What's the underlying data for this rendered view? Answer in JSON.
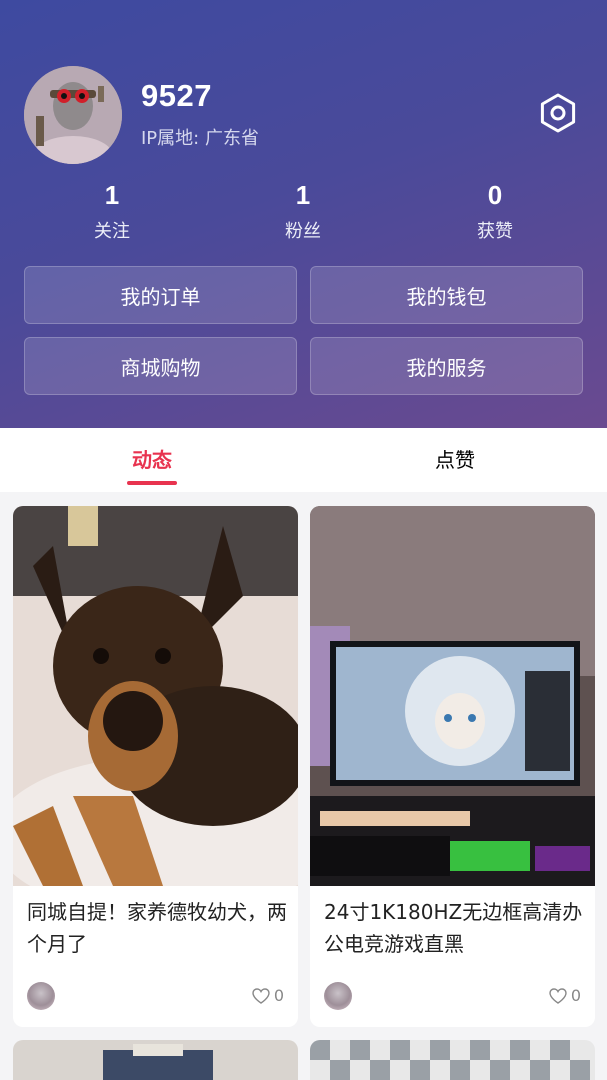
{
  "profile": {
    "username": "9527",
    "ip_location": "IP属地: 广东省",
    "avatar_icon": "avatar-image",
    "settings_icon": "gear-icon"
  },
  "stats": [
    {
      "value": "1",
      "label": "关注"
    },
    {
      "value": "1",
      "label": "粉丝"
    },
    {
      "value": "0",
      "label": "获赞"
    }
  ],
  "quick_buttons": [
    {
      "label": "我的订单"
    },
    {
      "label": "我的钱包"
    },
    {
      "label": "商城购物"
    },
    {
      "label": "我的服务"
    }
  ],
  "tabs": [
    {
      "label": "动态",
      "active": true
    },
    {
      "label": "点赞",
      "active": false
    }
  ],
  "posts": [
    {
      "title": "同城自提！家养德牧幼犬，两个月了",
      "likes": "0",
      "image": "german-shepherd-puppy-photo"
    },
    {
      "title": "24寸1K180HZ无边框高清办公电竞游戏直黑",
      "likes": "0",
      "image": "gaming-monitor-desk-photo"
    }
  ],
  "colors": {
    "accent": "#e8334f",
    "header_start": "#3e4aa0",
    "header_end": "#6a4a90"
  }
}
